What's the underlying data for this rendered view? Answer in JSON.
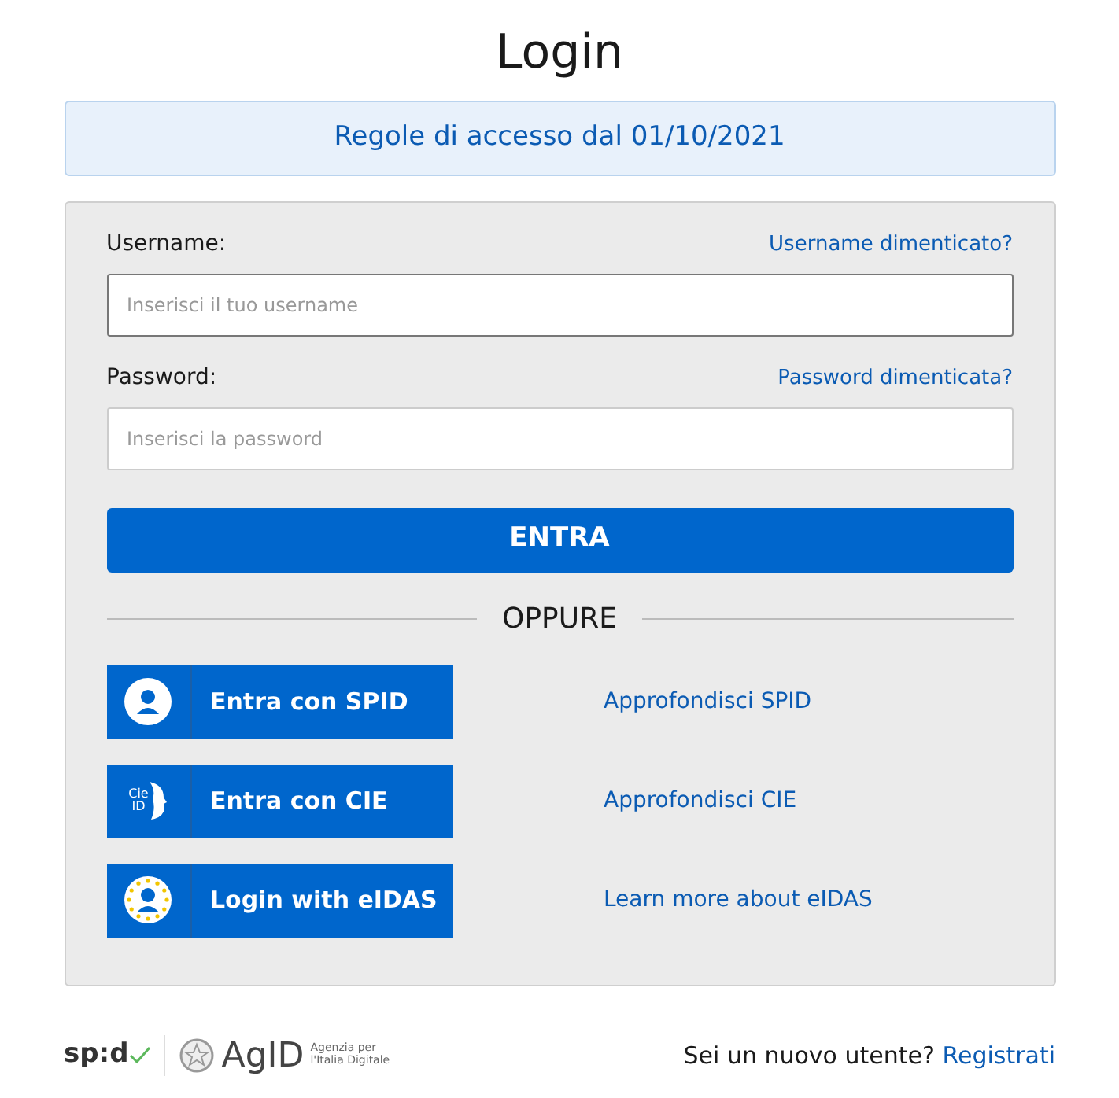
{
  "title": "Login",
  "notice": "Regole di accesso dal 01/10/2021",
  "fields": [
    {
      "label": "Username:",
      "link": "Username dimenticato?",
      "placeholder": "Inserisci il tuo username",
      "focused": true
    },
    {
      "label": "Password:",
      "link": "Password dimenticata?",
      "placeholder": "Inserisci la password",
      "focused": false
    }
  ],
  "submit": "ENTRA",
  "separator": "OPPURE",
  "providers": [
    {
      "kind": "spid",
      "label": "Entra con SPID",
      "link": "Approfondisci SPID"
    },
    {
      "kind": "cie",
      "label": "Entra con CIE",
      "link": "Approfondisci CIE",
      "icon_text": [
        "Cie",
        "ID"
      ]
    },
    {
      "kind": "eidas",
      "label": "Login with eIDAS",
      "link": "Learn more about eIDAS"
    }
  ],
  "footer": {
    "spid_logo": "sp:d",
    "agid_logo": "AgID",
    "agid_caption": [
      "Agenzia per",
      "l'Italia Digitale"
    ],
    "question": "Sei un nuovo utente?",
    "register": "Registrati"
  }
}
